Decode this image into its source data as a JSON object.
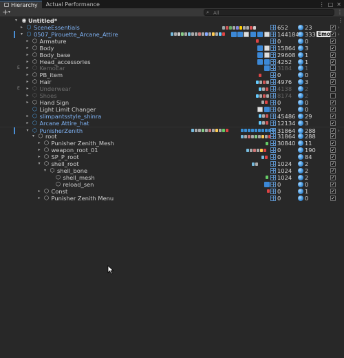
{
  "tabs": [
    {
      "label": "Hierarchy",
      "active": true
    },
    {
      "label": "Actual Performance",
      "active": false
    }
  ],
  "tab_menu_glyphs": [
    "⋮",
    "□",
    "✕"
  ],
  "toolbar": {
    "add_label": "+",
    "add_caret": "▾",
    "search_placeholder": "All",
    "menu_glyph": "⋮"
  },
  "scene": {
    "name": "Untitled*"
  },
  "rows": [
    {
      "name": "SceneEssentials",
      "count1": "652",
      "count2": "23",
      "checked": true
    },
    {
      "name": "0507_Pirouette_Arcane_Attire",
      "count1": "144184",
      "count2": "333",
      "badge": "Emo",
      "checked": true
    },
    {
      "name": "Armature",
      "count1": "0",
      "count2": "0",
      "checked": true
    },
    {
      "name": "Body",
      "count1": "15864",
      "count2": "3",
      "checked": true
    },
    {
      "name": "Body_base",
      "count1": "29608",
      "count2": "1",
      "checked": true
    },
    {
      "name": "Head_accessories",
      "count1": "4252",
      "count2": "1",
      "checked": true
    },
    {
      "name": "KemoEar",
      "count1": "3184",
      "count2": "1",
      "checked": false
    },
    {
      "name": "PB_item",
      "count1": "0",
      "count2": "0",
      "checked": true
    },
    {
      "name": "Hair",
      "count1": "4976",
      "count2": "3",
      "checked": true
    },
    {
      "name": "Underwear",
      "count1": "4138",
      "count2": "2",
      "checked": false
    },
    {
      "name": "Shoes",
      "count1": "8174",
      "count2": "2",
      "checked": false
    },
    {
      "name": "Hand Sign",
      "count1": "0",
      "count2": "0",
      "checked": true
    },
    {
      "name": "Light Limit Changer",
      "count1": "0",
      "count2": "0",
      "checked": true
    },
    {
      "name": "slimpantsstyle_shinra",
      "count1": "45486",
      "count2": "29",
      "checked": true
    },
    {
      "name": "Arcane Attire_hat",
      "count1": "12134",
      "count2": "3",
      "checked": true
    },
    {
      "name": "PunisherZenith",
      "count1": "31864",
      "count2": "288",
      "checked": true
    },
    {
      "name": "root",
      "count1": "31864",
      "count2": "288",
      "checked": true
    },
    {
      "name": "Punisher Zenith_Mesh",
      "count1": "30840",
      "count2": "11",
      "checked": true
    },
    {
      "name": "weapon_root_01",
      "count1": "0",
      "count2": "190",
      "checked": true
    },
    {
      "name": "SP_P_root",
      "count1": "0",
      "count2": "84",
      "checked": true
    },
    {
      "name": "shell_root",
      "count1": "1024",
      "count2": "2",
      "checked": true
    },
    {
      "name": "shell_bone",
      "count1": "1024",
      "count2": "2",
      "checked": true
    },
    {
      "name": "shell_mesh",
      "count1": "1024",
      "count2": "2",
      "checked": true
    },
    {
      "name": "reload_sen",
      "count1": "0",
      "count2": "0",
      "checked": true
    },
    {
      "name": "Const",
      "count1": "0",
      "count2": "1",
      "checked": true
    },
    {
      "name": "Punisher Zenith Menu",
      "count1": "0",
      "count2": "0",
      "checked": true
    }
  ],
  "gutter_marks": {
    "e_glyph": "E"
  },
  "icons": {
    "expand_open": "▾",
    "expand_closed": "▸",
    "gameobject": "cube-icon",
    "prefab": "prefab-cube-icon",
    "checkmark": "✓",
    "row_arrow": "›"
  },
  "colors": {
    "background": "#282828",
    "prefab_name": "#7fb3f5",
    "accent": "#3a79bb",
    "inactive_name": "#6d6d6d"
  }
}
